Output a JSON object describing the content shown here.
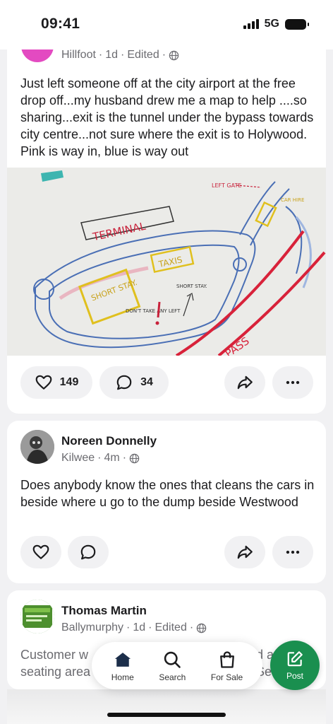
{
  "status": {
    "time": "09:41",
    "network": "5G"
  },
  "posts": [
    {
      "location": "Hillfoot",
      "age": "1d",
      "edited": "Edited",
      "text": "Just left someone off at the city airport at the free drop off...my husband drew me a map to help ....so sharing...exit is the tunnel under the bypass towards city centre...not sure where the exit is to Holywood. Pink is way in, blue is way out",
      "image_labels": {
        "terminal": "TERMINAL",
        "taxis": "TAXIS",
        "short_stay_box": "SHORT STAY.",
        "short_stay_arrow": "SHORT STAY.",
        "dont_take": "DON'T TAKE ANY LEFT",
        "left_gate": "LEFT GATE",
        "car_hire": "CAR HIRE",
        "bypass": "Y PASS"
      },
      "likes": "149",
      "comments": "34"
    },
    {
      "author": "Noreen Donnelly",
      "location": "Kilwee",
      "age": "4m",
      "text": "Does anybody know the ones that cleans the cars in beside where u go to the dump beside Westwood"
    },
    {
      "author": "Thomas Martin",
      "location": "Ballymurphy",
      "age": "1d",
      "edited": "Edited",
      "text_left_1": "Customer w",
      "text_left_2": "seating area",
      "text_right_1": "and a",
      "text_right_2": "... Se"
    }
  ],
  "nav": {
    "home": "Home",
    "search": "Search",
    "for_sale": "For Sale",
    "post": "Post"
  },
  "colors": {
    "accent": "#1a8f4f",
    "background": "#f1f1f3"
  }
}
